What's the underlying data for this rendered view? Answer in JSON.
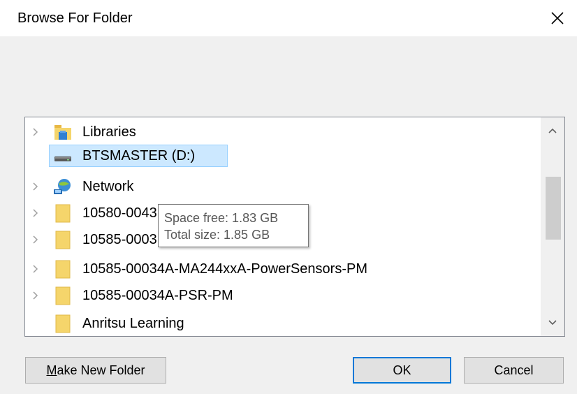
{
  "dialog": {
    "title": "Browse For Folder",
    "close_symbol": "✕"
  },
  "tree": {
    "items": [
      {
        "label": "Libraries",
        "icon": "libraries-icon",
        "expandable": true,
        "selected": false
      },
      {
        "label": "BTSMASTER (D:)",
        "icon": "drive-icon",
        "expandable": false,
        "selected": true
      },
      {
        "label": "Network",
        "icon": "network-icon",
        "expandable": true,
        "selected": false
      },
      {
        "label": "10580-0043",
        "icon": "folder-icon",
        "expandable": true,
        "selected": false
      },
      {
        "label": "10585-0003",
        "icon": "folder-icon",
        "expandable": true,
        "selected": false
      },
      {
        "label": "10585-00034A-MA244xxA-PowerSensors-PM",
        "icon": "folder-icon",
        "expandable": true,
        "selected": false
      },
      {
        "label": "10585-00034A-PSR-PM",
        "icon": "folder-icon",
        "expandable": true,
        "selected": false
      },
      {
        "label": "Anritsu Learning",
        "icon": "folder-icon",
        "expandable": false,
        "selected": false
      }
    ],
    "expander_symbol": ">",
    "scroll_up_symbol": "^",
    "scroll_down_symbol": "v"
  },
  "tooltip": {
    "space_free": "Space free: 1.83 GB",
    "total_size": "Total size: 1.85 GB"
  },
  "buttons": {
    "make_new_folder_mnemonic": "M",
    "make_new_folder_rest": "ake New Folder",
    "ok": "OK",
    "cancel": "Cancel"
  },
  "colors": {
    "selection": "#cce8ff",
    "folder": "#f5d56b",
    "accent": "#0078d7"
  }
}
